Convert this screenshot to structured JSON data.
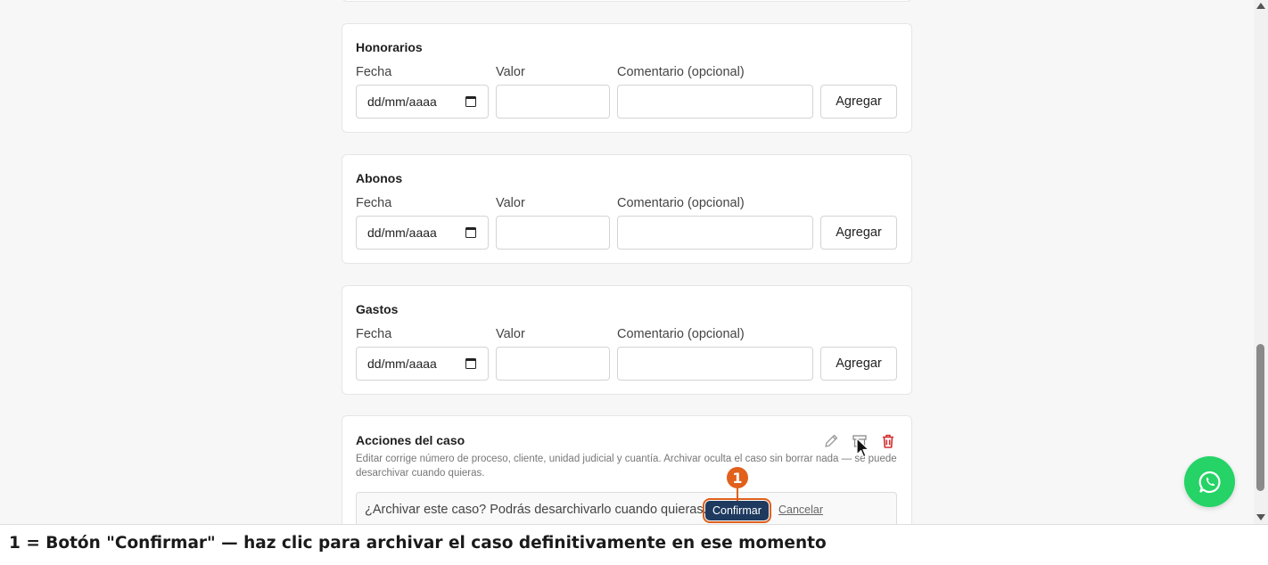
{
  "sections": [
    {
      "title": "Honorarios",
      "date_label": "Fecha",
      "date_placeholder": "dd/mm/aaaa",
      "value_label": "Valor",
      "comment_label": "Comentario (opcional)",
      "add_label": "Agregar"
    },
    {
      "title": "Abonos",
      "date_label": "Fecha",
      "date_placeholder": "dd/mm/aaaa",
      "value_label": "Valor",
      "comment_label": "Comentario (opcional)",
      "add_label": "Agregar"
    },
    {
      "title": "Gastos",
      "date_label": "Fecha",
      "date_placeholder": "dd/mm/aaaa",
      "value_label": "Valor",
      "comment_label": "Comentario (opcional)",
      "add_label": "Agregar"
    }
  ],
  "actions": {
    "title": "Acciones del caso",
    "description": "Editar corrige número de proceso, cliente, unidad judicial y cuantía. Archivar oculta el caso sin borrar nada — se puede desarchivar cuando quieras.",
    "icons": [
      "pencil-icon",
      "archive-icon",
      "trash-icon"
    ],
    "confirm_prompt": "¿Archivar este caso? Podrás desarchivarlo cuando quieras.",
    "confirm_label": "Confirmar",
    "cancel_label": "Cancelar"
  },
  "annotation": {
    "marker": "1",
    "caption": "1 = Botón \"Confirmar\" — haz clic para archivar el caso definitivamente en ese momento"
  },
  "colors": {
    "confirm_bg": "#1e3a5f",
    "highlight": "#e0601c",
    "whatsapp": "#25d366",
    "trash": "#d32f2f"
  }
}
